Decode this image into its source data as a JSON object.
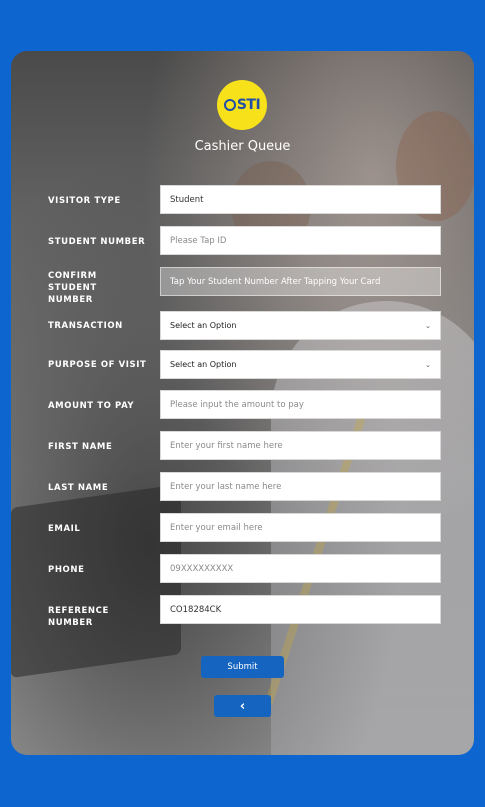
{
  "app": {
    "logo_text": "STI",
    "title": "Cashier Queue"
  },
  "form": {
    "visitor_type": {
      "label": "VISITOR TYPE",
      "value": "Student"
    },
    "student_number": {
      "label": "STUDENT NUMBER",
      "placeholder": "Please Tap ID"
    },
    "confirm_student_number": {
      "label_line1": "CONFIRM STUDENT",
      "label_line2": "NUMBER",
      "placeholder": "Tap Your Student Number After Tapping Your Card"
    },
    "transaction": {
      "label": "TRANSACTION",
      "value": "Select an Option"
    },
    "purpose_of_visit": {
      "label": "PURPOSE OF VISIT",
      "value": "Select an Option"
    },
    "amount_to_pay": {
      "label": "AMOUNT TO PAY",
      "placeholder": "Please input the amount to pay"
    },
    "first_name": {
      "label": "FIRST NAME",
      "placeholder": "Enter your first name here"
    },
    "last_name": {
      "label": "LAST NAME",
      "placeholder": "Enter your last name here"
    },
    "email": {
      "label": "EMAIL",
      "placeholder": "Enter your email here"
    },
    "phone": {
      "label": "PHONE",
      "placeholder": "09XXXXXXXXX"
    },
    "reference_number": {
      "label": "REFERENCE NUMBER",
      "value": "CO18284CK"
    }
  },
  "actions": {
    "submit_label": "Submit",
    "back_label": "‹"
  },
  "colors": {
    "page_background": "#0d66d0",
    "button": "#1565c0",
    "logo": "#f7e11a"
  }
}
